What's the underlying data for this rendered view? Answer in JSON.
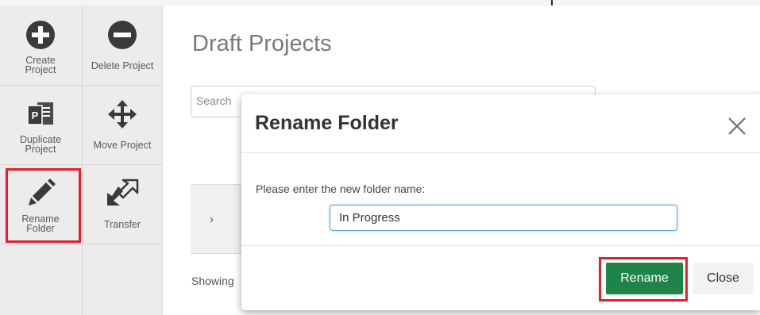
{
  "sidebar": {
    "tiles": [
      {
        "label": "Create Project",
        "icon": "plus-circle-icon"
      },
      {
        "label": "Delete Project",
        "icon": "minus-circle-icon"
      },
      {
        "label": "Duplicate Project",
        "icon": "duplicate-project-icon"
      },
      {
        "label": "Move Project",
        "icon": "move-arrows-icon"
      },
      {
        "label": "Rename Folder",
        "icon": "pencil-icon"
      },
      {
        "label": "Transfer",
        "icon": "transfer-icon"
      }
    ]
  },
  "main": {
    "title": "Draft Projects",
    "search_placeholder": "Search",
    "row_chevron": "›",
    "showing_text": "Showing"
  },
  "modal": {
    "title": "Rename Folder",
    "prompt": "Please enter the new folder name:",
    "input_value": "In Progress",
    "rename_label": "Rename",
    "close_label": "Close"
  },
  "colors": {
    "accent_green": "#1e8449",
    "highlight_red": "#e2202b",
    "sidebar_bg": "#ececec",
    "icon_dark": "#3a3a3a"
  }
}
